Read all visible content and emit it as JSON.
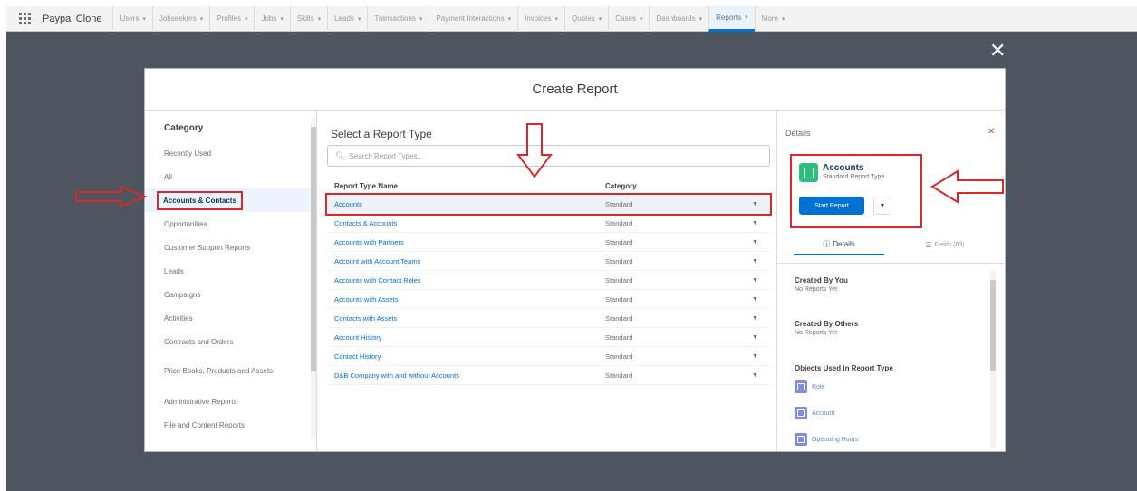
{
  "topnav": {
    "app_name": "Paypal Clone",
    "tabs": [
      {
        "label": "Users"
      },
      {
        "label": "Jobseekers"
      },
      {
        "label": "Profiles"
      },
      {
        "label": "Jobs"
      },
      {
        "label": "Skills"
      },
      {
        "label": "Leads"
      },
      {
        "label": "Transactions"
      },
      {
        "label": "Payment Interactions"
      },
      {
        "label": "Invoices"
      },
      {
        "label": "Quotes"
      },
      {
        "label": "Cases"
      },
      {
        "label": "Dashboards"
      },
      {
        "label": "Reports",
        "active": true
      },
      {
        "label": "More"
      }
    ]
  },
  "overlay_close_glyph": "✕",
  "modal": {
    "title": "Create Report",
    "categories": {
      "heading": "Category",
      "items": [
        "Recently Used",
        "All",
        "Accounts & Contacts",
        "Opportunities",
        "Customer Support Reports",
        "Leads",
        "Campaigns",
        "Activities",
        "Contracts and Orders",
        "Price Books, Products and Assets",
        "Administrative Reports",
        "File and Content Reports"
      ],
      "selected": "Accounts & Contacts"
    },
    "report_types": {
      "heading": "Select a Report Type",
      "search_placeholder": "Search Report Types...",
      "columns": [
        "Report Type Name",
        "Category"
      ],
      "rows": [
        {
          "name": "Accounts",
          "category": "Standard",
          "selected": true
        },
        {
          "name": "Contacts & Accounts",
          "category": "Standard"
        },
        {
          "name": "Accounts with Partners",
          "category": "Standard"
        },
        {
          "name": "Account with Account Teams",
          "category": "Standard"
        },
        {
          "name": "Accounts with Contact Roles",
          "category": "Standard"
        },
        {
          "name": "Accounts with Assets",
          "category": "Standard"
        },
        {
          "name": "Contacts with Assets",
          "category": "Standard"
        },
        {
          "name": "Account History",
          "category": "Standard"
        },
        {
          "name": "Contact History",
          "category": "Standard"
        },
        {
          "name": "D&B Company with and without Accounts",
          "category": "Standard"
        }
      ]
    },
    "details": {
      "heading": "Details",
      "report_type_name": "Accounts",
      "report_type_kind": "Standard Report Type",
      "start_button": "Start Report",
      "tabs": [
        "Details",
        "Fields (63)"
      ],
      "created_by_you": {
        "title": "Created By You",
        "value": "No Reports Yet"
      },
      "created_by_others": {
        "title": "Created By Others",
        "value": "No Reports Yet"
      },
      "objects_heading": "Objects Used in Report Type",
      "objects": [
        {
          "label": "Role",
          "color": "#7f8de1"
        },
        {
          "label": "Account",
          "color": "#7f8de1"
        },
        {
          "label": "Operating Hours",
          "color": "#7f8de1"
        }
      ]
    }
  },
  "colors": {
    "accent": "#0070d2",
    "highlight": "#d62a2a",
    "backdrop": "#4d5560"
  }
}
